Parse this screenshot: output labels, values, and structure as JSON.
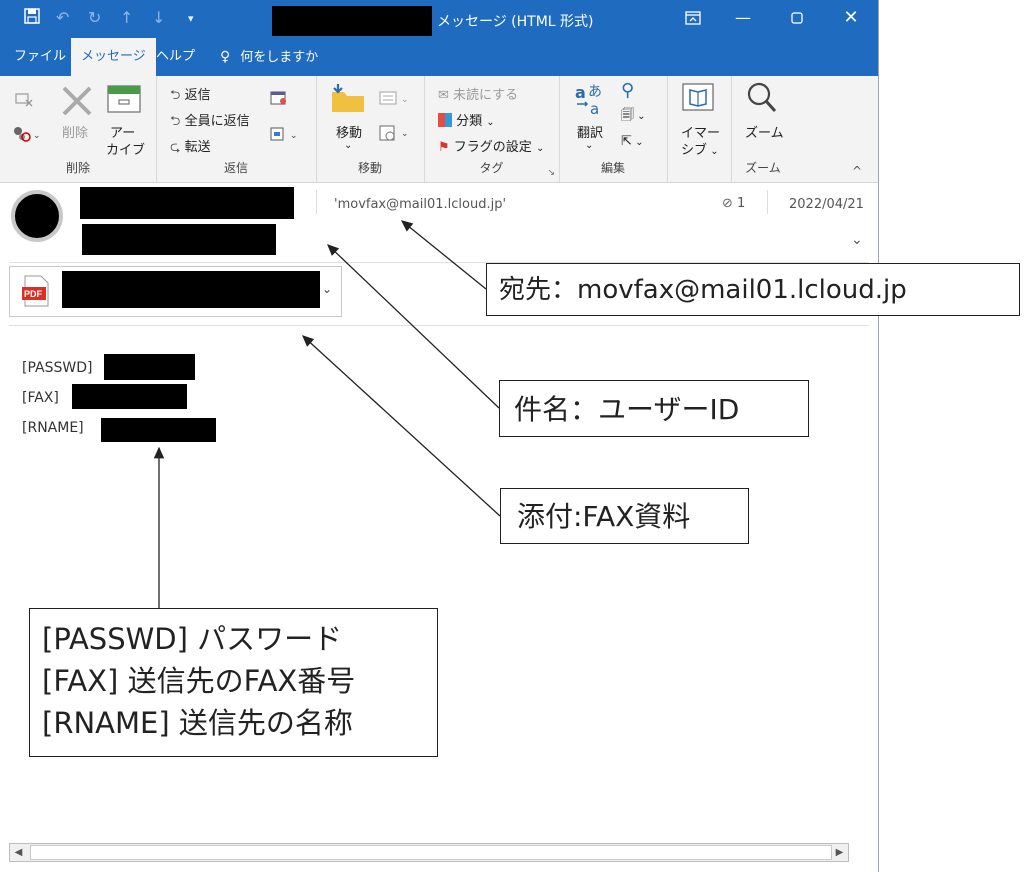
{
  "window": {
    "title": "メッセージ (HTML 形式)"
  },
  "tabs": [
    {
      "label": "ファイル"
    },
    {
      "label": "メッセージ"
    },
    {
      "label": "ヘルプ"
    },
    {
      "label": "何をしますか"
    }
  ],
  "ribbon": {
    "delete_group": {
      "label": "削除",
      "delete": "削除",
      "archive_line1": "アー",
      "archive_line2": "カイブ"
    },
    "reply_group": {
      "label": "返信",
      "reply": "返信",
      "reply_all": "全員に返信",
      "forward": "転送"
    },
    "move_group": {
      "label": "移動",
      "move": "移動"
    },
    "tags_group": {
      "label": "タグ",
      "unread": "未読にする",
      "categorize": "分類",
      "flag": "フラグの設定"
    },
    "edit_group": {
      "label": "編集",
      "translate": "翻訳"
    },
    "immersive_group": {
      "line1": "イマー",
      "line2": "シブ"
    },
    "zoom_group": {
      "label": "ズーム",
      "zoom": "ズーム"
    }
  },
  "message": {
    "to": "'movfax@mail01.lcloud.jp'",
    "attachment_count": "1",
    "date": "2022/04/21",
    "body": [
      "[PASSWD]",
      "[FAX]",
      "[RNAME]"
    ]
  },
  "attachment": {
    "type_badge": "PDF"
  },
  "annotations": {
    "to_label": "宛先：movfax@mail01.lcloud.jp",
    "subject_label": "件名：ユーザーID",
    "attach_label": "添付:FAX資料",
    "legend": [
      "[PASSWD] パスワード",
      "[FAX] 送信先のFAX番号",
      "[RNAME] 送信先の名称"
    ]
  }
}
